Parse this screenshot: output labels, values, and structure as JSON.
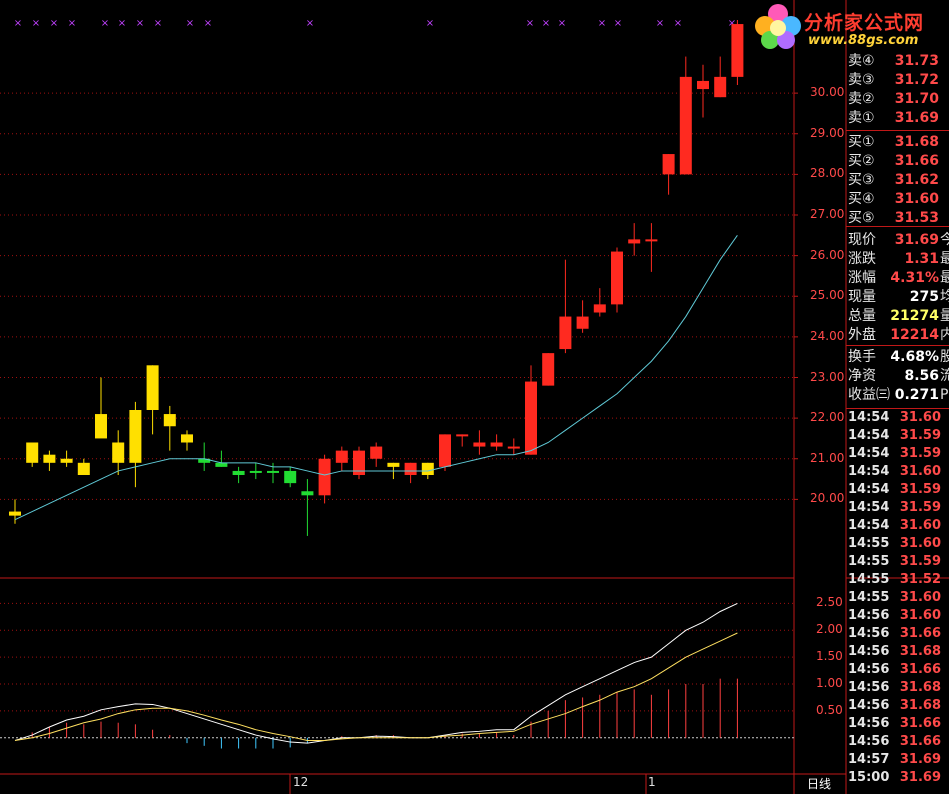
{
  "logo": {
    "title": "分析家公式网",
    "url": "www.88gs.com"
  },
  "price_axis": [
    "30.00",
    "29.00",
    "28.00",
    "27.00",
    "26.00",
    "25.00",
    "24.00",
    "23.00",
    "22.00",
    "21.00",
    "20.00"
  ],
  "macd_axis": [
    "2.50",
    "2.00",
    "1.50",
    "1.00",
    "0.50"
  ],
  "date_labels": [
    "12",
    "1"
  ],
  "period_button": "日线",
  "orderbook": {
    "sell": [
      {
        "label": "卖④",
        "price": "31.73"
      },
      {
        "label": "卖③",
        "price": "31.72"
      },
      {
        "label": "卖②",
        "price": "31.70"
      },
      {
        "label": "卖①",
        "price": "31.69"
      }
    ],
    "buy": [
      {
        "label": "买①",
        "price": "31.68"
      },
      {
        "label": "买②",
        "price": "31.66"
      },
      {
        "label": "买③",
        "price": "31.62"
      },
      {
        "label": "买④",
        "price": "31.60"
      },
      {
        "label": "买⑤",
        "price": "31.53"
      }
    ]
  },
  "quote": [
    {
      "label": "现价",
      "value": "31.69",
      "tail": "今",
      "color": "#ff4a4a"
    },
    {
      "label": "涨跌",
      "value": "1.31",
      "tail": "最",
      "color": "#ff4a4a"
    },
    {
      "label": "涨幅",
      "value": "4.31%",
      "tail": "最",
      "color": "#ff4a4a"
    },
    {
      "label": "现量",
      "value": "275",
      "tail": "均",
      "color": "#ffffff"
    },
    {
      "label": "总量",
      "value": "21274",
      "tail": "量",
      "color": "#ffff66"
    },
    {
      "label": "外盘",
      "value": "12214",
      "tail": "内",
      "color": "#ff4a4a"
    }
  ],
  "stats": [
    {
      "label": "换手",
      "value": "4.68%",
      "tail": "股",
      "color": "#ffffff"
    },
    {
      "label": "净资",
      "value": "8.56",
      "tail": "流",
      "color": "#ffffff"
    },
    {
      "label": "收益㈢",
      "value": "0.271",
      "tail": "P",
      "color": "#ffffff"
    }
  ],
  "ticks": [
    {
      "time": "14:54",
      "price": "31.60",
      "color": "#ff4a4a"
    },
    {
      "time": "14:54",
      "price": "31.59",
      "color": "#ff4a4a"
    },
    {
      "time": "14:54",
      "price": "31.59",
      "color": "#ff4a4a"
    },
    {
      "time": "14:54",
      "price": "31.60",
      "color": "#ff4a4a"
    },
    {
      "time": "14:54",
      "price": "31.59",
      "color": "#ff4a4a"
    },
    {
      "time": "14:54",
      "price": "31.59",
      "color": "#ff4a4a"
    },
    {
      "time": "14:54",
      "price": "31.60",
      "color": "#ff4a4a"
    },
    {
      "time": "14:55",
      "price": "31.60",
      "color": "#ff4a4a"
    },
    {
      "time": "14:55",
      "price": "31.59",
      "color": "#ff4a4a"
    },
    {
      "time": "14:55",
      "price": "31.52",
      "color": "#ff4a4a"
    },
    {
      "time": "14:55",
      "price": "31.60",
      "color": "#ff4a4a"
    },
    {
      "time": "14:56",
      "price": "31.60",
      "color": "#ff4a4a"
    },
    {
      "time": "14:56",
      "price": "31.66",
      "color": "#ff4a4a"
    },
    {
      "time": "14:56",
      "price": "31.68",
      "color": "#ff4a4a"
    },
    {
      "time": "14:56",
      "price": "31.66",
      "color": "#ff4a4a"
    },
    {
      "time": "14:56",
      "price": "31.68",
      "color": "#ff4a4a"
    },
    {
      "time": "14:56",
      "price": "31.68",
      "color": "#ff4a4a"
    },
    {
      "time": "14:56",
      "price": "31.66",
      "color": "#ff4a4a"
    },
    {
      "time": "14:56",
      "price": "31.66",
      "color": "#ff4a4a"
    },
    {
      "time": "14:57",
      "price": "31.69",
      "color": "#ff4a4a"
    },
    {
      "time": "15:00",
      "price": "31.69",
      "color": "#ff4a4a"
    }
  ],
  "colors": {
    "up": "#ff2a20",
    "yellow": "#ffe000",
    "green": "#22dd33",
    "ma": "#5fc9d6",
    "grid": "#a01010",
    "axis": "#c01818"
  },
  "chart_data": {
    "type": "candlestick",
    "title": "",
    "price_range": [
      19.0,
      31.8
    ],
    "candles": [
      {
        "o": 19.7,
        "h": 20.0,
        "l": 19.4,
        "c": 19.6,
        "col": "yellow"
      },
      {
        "o": 21.4,
        "h": 21.4,
        "l": 20.8,
        "c": 20.9,
        "col": "yellow"
      },
      {
        "o": 21.1,
        "h": 21.2,
        "l": 20.7,
        "c": 20.9,
        "col": "yellow"
      },
      {
        "o": 21.0,
        "h": 21.2,
        "l": 20.8,
        "c": 20.9,
        "col": "yellow"
      },
      {
        "o": 20.9,
        "h": 21.0,
        "l": 20.6,
        "c": 20.6,
        "col": "yellow"
      },
      {
        "o": 22.1,
        "h": 23.0,
        "l": 21.6,
        "c": 21.5,
        "col": "yellow"
      },
      {
        "o": 21.4,
        "h": 21.7,
        "l": 20.6,
        "c": 20.9,
        "col": "yellow"
      },
      {
        "o": 22.2,
        "h": 22.4,
        "l": 20.3,
        "c": 20.9,
        "col": "yellow"
      },
      {
        "o": 23.3,
        "h": 23.3,
        "l": 21.6,
        "c": 22.2,
        "col": "yellow"
      },
      {
        "o": 22.1,
        "h": 22.3,
        "l": 21.2,
        "c": 21.8,
        "col": "yellow"
      },
      {
        "o": 21.6,
        "h": 21.7,
        "l": 21.2,
        "c": 21.4,
        "col": "yellow"
      },
      {
        "o": 20.9,
        "h": 21.4,
        "l": 20.7,
        "c": 21.0,
        "col": "green"
      },
      {
        "o": 20.9,
        "h": 21.2,
        "l": 20.8,
        "c": 20.8,
        "col": "green"
      },
      {
        "o": 20.7,
        "h": 20.8,
        "l": 20.4,
        "c": 20.6,
        "col": "green"
      },
      {
        "o": 20.7,
        "h": 20.9,
        "l": 20.5,
        "c": 20.7,
        "col": "green"
      },
      {
        "o": 20.7,
        "h": 20.9,
        "l": 20.4,
        "c": 20.7,
        "col": "green"
      },
      {
        "o": 20.7,
        "h": 20.8,
        "l": 20.3,
        "c": 20.4,
        "col": "green"
      },
      {
        "o": 20.2,
        "h": 20.5,
        "l": 19.1,
        "c": 20.1,
        "col": "green"
      },
      {
        "o": 20.1,
        "h": 21.1,
        "l": 19.9,
        "c": 21.0,
        "col": "up"
      },
      {
        "o": 20.9,
        "h": 21.3,
        "l": 20.7,
        "c": 21.2,
        "col": "up"
      },
      {
        "o": 20.6,
        "h": 21.3,
        "l": 20.5,
        "c": 21.2,
        "col": "up"
      },
      {
        "o": 21.0,
        "h": 21.4,
        "l": 20.8,
        "c": 21.3,
        "col": "up"
      },
      {
        "o": 20.8,
        "h": 20.9,
        "l": 20.5,
        "c": 20.9,
        "col": "yellow"
      },
      {
        "o": 20.6,
        "h": 20.9,
        "l": 20.4,
        "c": 20.9,
        "col": "up"
      },
      {
        "o": 20.9,
        "h": 20.9,
        "l": 20.5,
        "c": 20.6,
        "col": "yellow"
      },
      {
        "o": 20.8,
        "h": 21.6,
        "l": 20.7,
        "c": 21.6,
        "col": "up"
      },
      {
        "o": 21.6,
        "h": 21.6,
        "l": 21.3,
        "c": 21.6,
        "col": "up"
      },
      {
        "o": 21.3,
        "h": 21.7,
        "l": 21.1,
        "c": 21.4,
        "col": "up"
      },
      {
        "o": 21.3,
        "h": 21.6,
        "l": 21.2,
        "c": 21.4,
        "col": "up"
      },
      {
        "o": 21.3,
        "h": 21.5,
        "l": 21.1,
        "c": 21.3,
        "col": "up"
      },
      {
        "o": 21.1,
        "h": 23.3,
        "l": 21.1,
        "c": 22.9,
        "col": "up"
      },
      {
        "o": 22.8,
        "h": 23.6,
        "l": 22.8,
        "c": 23.6,
        "col": "up"
      },
      {
        "o": 23.7,
        "h": 25.9,
        "l": 23.6,
        "c": 24.5,
        "col": "up"
      },
      {
        "o": 24.2,
        "h": 24.9,
        "l": 24.1,
        "c": 24.5,
        "col": "up"
      },
      {
        "o": 24.6,
        "h": 25.2,
        "l": 24.5,
        "c": 24.8,
        "col": "up"
      },
      {
        "o": 24.8,
        "h": 26.2,
        "l": 24.6,
        "c": 26.1,
        "col": "up"
      },
      {
        "o": 26.3,
        "h": 26.8,
        "l": 26.0,
        "c": 26.4,
        "col": "up"
      },
      {
        "o": 26.4,
        "h": 26.8,
        "l": 25.6,
        "c": 26.4,
        "col": "up"
      },
      {
        "o": 28.0,
        "h": 28.5,
        "l": 27.5,
        "c": 28.5,
        "col": "up"
      },
      {
        "o": 28.0,
        "h": 30.9,
        "l": 28.0,
        "c": 30.4,
        "col": "up"
      },
      {
        "o": 30.1,
        "h": 30.7,
        "l": 29.4,
        "c": 30.3,
        "col": "up"
      },
      {
        "o": 29.9,
        "h": 30.9,
        "l": 29.9,
        "c": 30.4,
        "col": "up"
      },
      {
        "o": 30.4,
        "h": 31.8,
        "l": 30.2,
        "c": 31.7,
        "col": "up"
      }
    ],
    "ma": [
      19.5,
      19.7,
      19.9,
      20.1,
      20.3,
      20.5,
      20.7,
      20.8,
      20.9,
      21.0,
      21.0,
      21.0,
      20.9,
      20.9,
      20.9,
      20.8,
      20.8,
      20.7,
      20.6,
      20.7,
      20.7,
      20.7,
      20.7,
      20.7,
      20.7,
      20.8,
      20.9,
      21.0,
      21.1,
      21.1,
      21.2,
      21.4,
      21.7,
      22.0,
      22.3,
      22.6,
      23.0,
      23.4,
      23.9,
      24.5,
      25.2,
      25.9,
      26.5
    ],
    "macd_range": [
      -0.6,
      2.75
    ],
    "dif": [
      -0.05,
      0.05,
      0.2,
      0.33,
      0.4,
      0.52,
      0.58,
      0.63,
      0.62,
      0.55,
      0.45,
      0.35,
      0.25,
      0.15,
      0.05,
      -0.02,
      -0.08,
      -0.1,
      -0.05,
      0.0,
      0.0,
      0.03,
      0.02,
      0.0,
      0.0,
      0.05,
      0.1,
      0.12,
      0.15,
      0.15,
      0.4,
      0.6,
      0.8,
      0.95,
      1.1,
      1.25,
      1.4,
      1.5,
      1.75,
      2.0,
      2.15,
      2.35,
      2.5
    ],
    "dea": [
      -0.05,
      0.0,
      0.08,
      0.18,
      0.28,
      0.35,
      0.45,
      0.52,
      0.55,
      0.55,
      0.5,
      0.42,
      0.33,
      0.25,
      0.15,
      0.08,
      0.02,
      -0.05,
      -0.05,
      -0.02,
      0.0,
      0.0,
      0.0,
      0.0,
      0.0,
      0.03,
      0.05,
      0.08,
      0.1,
      0.12,
      0.25,
      0.35,
      0.45,
      0.58,
      0.7,
      0.85,
      0.95,
      1.1,
      1.3,
      1.5,
      1.65,
      1.8,
      1.95
    ],
    "macd": [
      0.0,
      0.1,
      0.2,
      0.28,
      0.25,
      0.3,
      0.28,
      0.25,
      0.15,
      0.05,
      -0.1,
      -0.15,
      -0.2,
      -0.2,
      -0.2,
      -0.2,
      -0.18,
      -0.1,
      0.0,
      0.03,
      0.0,
      0.05,
      0.05,
      0.0,
      0.0,
      0.05,
      0.08,
      0.08,
      0.1,
      0.05,
      0.3,
      0.5,
      0.7,
      0.75,
      0.8,
      0.85,
      0.9,
      0.8,
      0.9,
      1.0,
      1.0,
      1.1,
      1.1
    ]
  }
}
